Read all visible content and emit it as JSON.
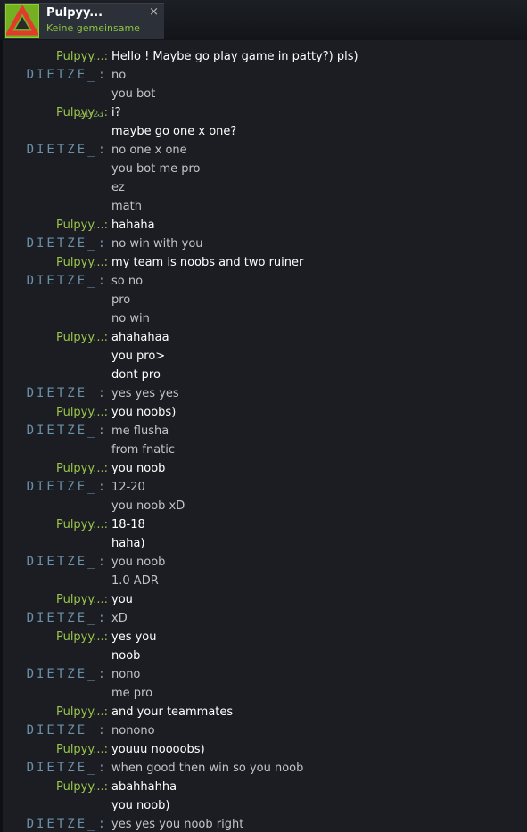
{
  "tab": {
    "name": "Pulpyy...",
    "status": "Keine gemeinsame",
    "close_label": "×"
  },
  "chat": {
    "timestamp": "21:23",
    "messages": [
      {
        "sender": "Pulpyy...:",
        "who": "pulp",
        "text": "Hello ! Maybe go play game in patty?) pls)"
      },
      {
        "sender": "DIETZE_:",
        "who": "dietze",
        "text": "no"
      },
      {
        "sender": "",
        "who": "dietze",
        "text": "you bot"
      },
      {
        "sender": "Pulpyy...:",
        "who": "pulp",
        "text": "i?"
      },
      {
        "sender": "",
        "who": "pulp",
        "text": "maybe go one x one?"
      },
      {
        "sender": "DIETZE_:",
        "who": "dietze",
        "text": "no one x one"
      },
      {
        "sender": "",
        "who": "dietze",
        "text": "you bot me pro"
      },
      {
        "sender": "",
        "who": "dietze",
        "text": "ez"
      },
      {
        "sender": "",
        "who": "dietze",
        "text": "math"
      },
      {
        "sender": "Pulpyy...:",
        "who": "pulp",
        "text": "hahaha"
      },
      {
        "sender": "DIETZE_:",
        "who": "dietze",
        "text": "no win with you"
      },
      {
        "sender": "Pulpyy...:",
        "who": "pulp",
        "text": "my team is noobs and two ruiner"
      },
      {
        "sender": "DIETZE_:",
        "who": "dietze",
        "text": "so no"
      },
      {
        "sender": "",
        "who": "dietze",
        "text": "pro"
      },
      {
        "sender": "",
        "who": "dietze",
        "text": "no win"
      },
      {
        "sender": "Pulpyy...:",
        "who": "pulp",
        "text": "ahahahaa"
      },
      {
        "sender": "",
        "who": "pulp",
        "text": "you pro>"
      },
      {
        "sender": "",
        "who": "pulp",
        "text": "dont pro"
      },
      {
        "sender": "DIETZE_:",
        "who": "dietze",
        "text": "yes yes yes"
      },
      {
        "sender": "Pulpyy...:",
        "who": "pulp",
        "text": "you noobs)"
      },
      {
        "sender": "DIETZE_:",
        "who": "dietze",
        "text": "me flusha"
      },
      {
        "sender": "",
        "who": "dietze",
        "text": "from fnatic"
      },
      {
        "sender": "Pulpyy...:",
        "who": "pulp",
        "text": "you noob"
      },
      {
        "sender": "DIETZE_:",
        "who": "dietze",
        "text": "12-20"
      },
      {
        "sender": "",
        "who": "dietze",
        "text": "you noob xD"
      },
      {
        "sender": "Pulpyy...:",
        "who": "pulp",
        "text": "18-18"
      },
      {
        "sender": "",
        "who": "pulp",
        "text": "haha)"
      },
      {
        "sender": "DIETZE_:",
        "who": "dietze",
        "text": "you noob"
      },
      {
        "sender": "",
        "who": "dietze",
        "text": "1.0 ADR"
      },
      {
        "sender": "Pulpyy...:",
        "who": "pulp",
        "text": "you"
      },
      {
        "sender": "DIETZE_:",
        "who": "dietze",
        "text": "xD"
      },
      {
        "sender": "Pulpyy...:",
        "who": "pulp",
        "text": "yes you"
      },
      {
        "sender": "",
        "who": "pulp",
        "text": "noob"
      },
      {
        "sender": "DIETZE_:",
        "who": "dietze",
        "text": "nono"
      },
      {
        "sender": "",
        "who": "dietze",
        "text": "me pro"
      },
      {
        "sender": "Pulpyy...:",
        "who": "pulp",
        "text": "and your teammates"
      },
      {
        "sender": "DIETZE_:",
        "who": "dietze",
        "text": "nonono"
      },
      {
        "sender": "Pulpyy...:",
        "who": "pulp",
        "text": "youuu noooobs)"
      },
      {
        "sender": "DIETZE_:",
        "who": "dietze",
        "text": "when good then win so you noob"
      },
      {
        "sender": "Pulpyy...:",
        "who": "pulp",
        "text": "abahhahha"
      },
      {
        "sender": "",
        "who": "pulp",
        "text": "you noob)"
      },
      {
        "sender": "DIETZE_:",
        "who": "dietze",
        "text": "yes yes you noob right"
      }
    ]
  }
}
